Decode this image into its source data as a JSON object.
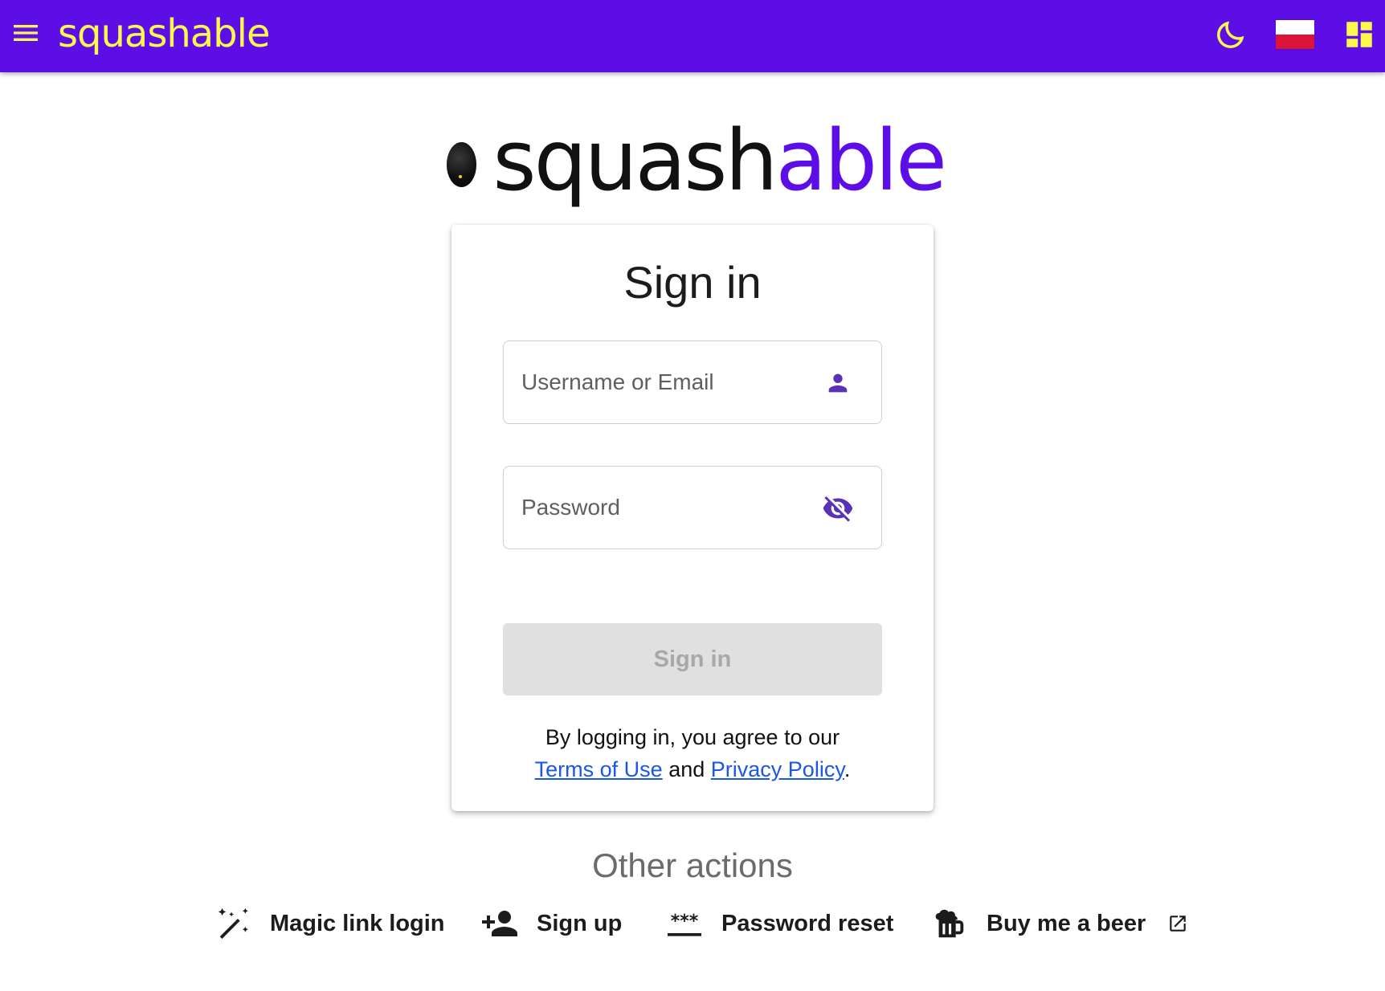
{
  "topbar": {
    "brand": "squashable",
    "icons": {
      "menu": "menu-icon",
      "theme": "moon-icon",
      "language": "poland-flag-icon",
      "apps": "dashboard-icon"
    },
    "colors": {
      "background": "#5d0ee6",
      "accent": "#fcf84d"
    }
  },
  "logo": {
    "text_main": "squash",
    "text_accent": "able",
    "accent_color": "#5d0ee6"
  },
  "signin": {
    "title": "Sign in",
    "username_placeholder": "Username or Email",
    "username_value": "",
    "password_placeholder": "Password",
    "password_value": "",
    "button_label": "Sign in",
    "agree_text": "By logging in, you agree to our",
    "terms_link": "Terms of Use",
    "and_text": "and",
    "privacy_link": "Privacy Policy",
    "period": "."
  },
  "other_actions": {
    "title": "Other actions",
    "items": [
      {
        "label": "Magic link login",
        "icon": "magic-wand-icon"
      },
      {
        "label": "Sign up",
        "icon": "person-add-icon"
      },
      {
        "label": "Password reset",
        "icon": "password-icon"
      },
      {
        "label": "Buy me a beer",
        "icon": "beer-icon",
        "external": "open-in-new-icon"
      }
    ]
  }
}
